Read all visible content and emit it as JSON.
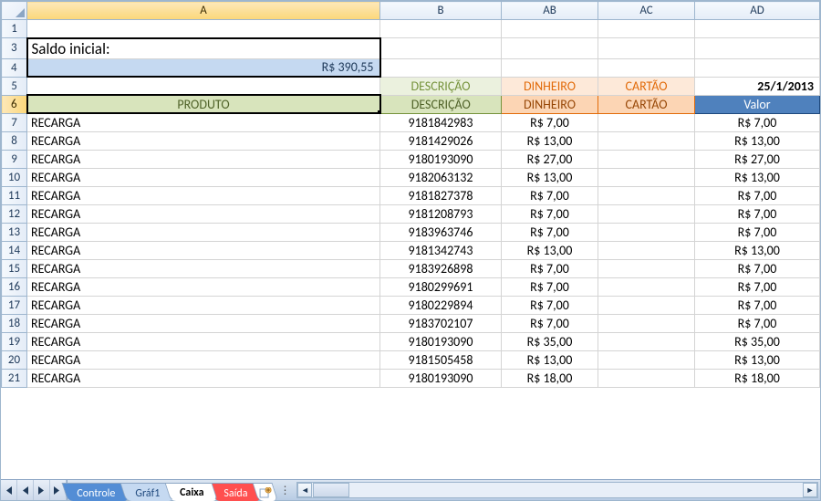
{
  "columns": {
    "rownum": "",
    "A": "A",
    "B": "B",
    "AB": "AB",
    "AC": "AC",
    "AD": "AD"
  },
  "saldo": {
    "label": "Saldo inicial:",
    "value": "R$ 390,55"
  },
  "row5": {
    "B": "DESCRIÇÃO",
    "AB": "DINHEIRO",
    "AC": "CARTÃO",
    "AD": "25/1/2013"
  },
  "row6": {
    "A": "PRODUTO",
    "B": "DESCRIÇÃO",
    "AB": "DINHEIRO",
    "AC": "CARTÃO",
    "AD": "Valor"
  },
  "rows": [
    {
      "n": 7,
      "A": "RECARGA",
      "B": "9181842983",
      "AB": "R$ 7,00",
      "AC": "",
      "AD": "R$ 7,00"
    },
    {
      "n": 8,
      "A": "RECARGA",
      "B": "9181429026",
      "AB": "R$ 13,00",
      "AC": "",
      "AD": "R$ 13,00"
    },
    {
      "n": 9,
      "A": "RECARGA",
      "B": "9180193090",
      "AB": "R$ 27,00",
      "AC": "",
      "AD": "R$ 27,00"
    },
    {
      "n": 10,
      "A": "RECARGA",
      "B": "9182063132",
      "AB": "R$ 13,00",
      "AC": "",
      "AD": "R$ 13,00"
    },
    {
      "n": 11,
      "A": "RECARGA",
      "B": "9181827378",
      "AB": "R$ 7,00",
      "AC": "",
      "AD": "R$ 7,00"
    },
    {
      "n": 12,
      "A": "RECARGA",
      "B": "9181208793",
      "AB": "R$ 7,00",
      "AC": "",
      "AD": "R$ 7,00"
    },
    {
      "n": 13,
      "A": "RECARGA",
      "B": "9183963746",
      "AB": "R$ 7,00",
      "AC": "",
      "AD": "R$ 7,00"
    },
    {
      "n": 14,
      "A": "RECARGA",
      "B": "9181342743",
      "AB": "R$ 13,00",
      "AC": "",
      "AD": "R$ 13,00"
    },
    {
      "n": 15,
      "A": "RECARGA",
      "B": "9183926898",
      "AB": "R$ 7,00",
      "AC": "",
      "AD": "R$ 7,00"
    },
    {
      "n": 16,
      "A": "RECARGA",
      "B": "9180299691",
      "AB": "R$ 7,00",
      "AC": "",
      "AD": "R$ 7,00"
    },
    {
      "n": 17,
      "A": "RECARGA",
      "B": "9180229894",
      "AB": "R$ 7,00",
      "AC": "",
      "AD": "R$ 7,00"
    },
    {
      "n": 18,
      "A": "RECARGA",
      "B": "9183702107",
      "AB": "R$ 7,00",
      "AC": "",
      "AD": "R$ 7,00"
    },
    {
      "n": 19,
      "A": "RECARGA",
      "B": "9180193090",
      "AB": "R$ 35,00",
      "AC": "",
      "AD": "R$ 35,00"
    },
    {
      "n": 20,
      "A": "RECARGA",
      "B": "9181505458",
      "AB": "R$ 13,00",
      "AC": "",
      "AD": "R$ 13,00"
    },
    {
      "n": 21,
      "A": "RECARGA",
      "B": "9180193090",
      "AB": "R$ 18,00",
      "AC": "",
      "AD": "R$ 18,00"
    }
  ],
  "tabs": {
    "controle": "Controle",
    "graf": "Gráf1",
    "caixa": "Caixa",
    "saida": "Saída"
  }
}
